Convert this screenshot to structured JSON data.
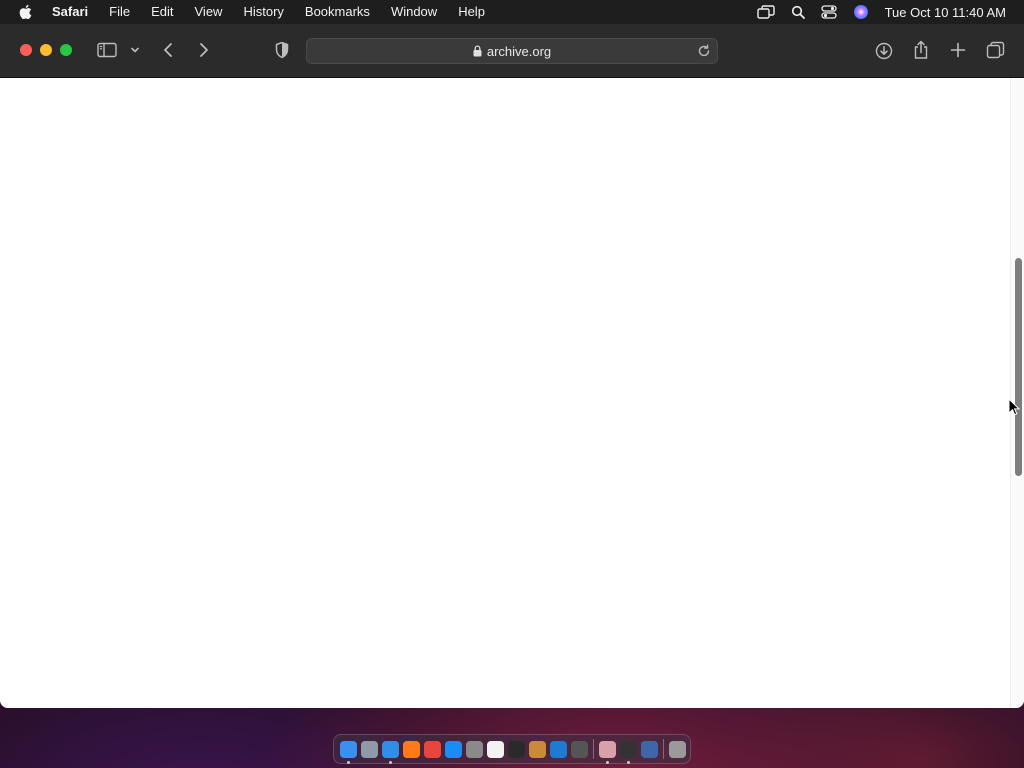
{
  "menubar": {
    "app_name": "Safari",
    "items": [
      "File",
      "Edit",
      "View",
      "History",
      "Bookmarks",
      "Window",
      "Help"
    ],
    "clock": "Tue Oct 10  11:40 AM",
    "status_icons": [
      "screen-mirroring-icon",
      "spotlight-search-icon",
      "control-center-icon",
      "siri-icon"
    ]
  },
  "browser": {
    "url": "archive.org",
    "toolbar_icons": [
      "sidebar-icon",
      "chevron-down-icon",
      "back-icon",
      "forward-icon",
      "privacy-shield-icon",
      "lock-icon",
      "reload-icon",
      "downloads-icon",
      "share-icon",
      "new-tab-icon",
      "tab-overview-icon"
    ]
  },
  "dock": {
    "apps": [
      {
        "name": "finder-icon",
        "color": "#3b8ff0",
        "running": true
      },
      {
        "name": "launchpad-icon",
        "color": "#8e9aa8",
        "running": false
      },
      {
        "name": "safari-icon",
        "color": "#2f8fe6",
        "running": true
      },
      {
        "name": "firefox-icon",
        "color": "#ff7a1a",
        "running": false
      },
      {
        "name": "chrome-icon",
        "color": "#e8453c",
        "running": false
      },
      {
        "name": "app-store-icon",
        "color": "#1a8cf5",
        "running": false
      },
      {
        "name": "system-settings-icon",
        "color": "#8a8a8a",
        "running": false
      },
      {
        "name": "textedit-icon",
        "color": "#f2f2f2",
        "running": false
      },
      {
        "name": "terminal-icon",
        "color": "#2a2a2a",
        "running": false
      },
      {
        "name": "paintbrush-icon",
        "color": "#c98a3a",
        "running": false
      },
      {
        "name": "vscode-icon",
        "color": "#1f7ad1",
        "running": false
      },
      {
        "name": "help-icon",
        "color": "#555555",
        "running": false
      },
      {
        "name": "preview-icon",
        "color": "#d8a0a8",
        "running": true
      },
      {
        "name": "piano-icon",
        "color": "#333333",
        "running": true
      },
      {
        "name": "virtualbox-icon",
        "color": "#3f66a8",
        "running": false
      },
      {
        "name": "trash-icon",
        "color": "#9a9a9a",
        "running": false
      }
    ]
  },
  "colors": {
    "menubar_bg": "#1e1e1e",
    "toolbar_bg": "#2b2b2b",
    "content_bg": "#ffffff"
  }
}
